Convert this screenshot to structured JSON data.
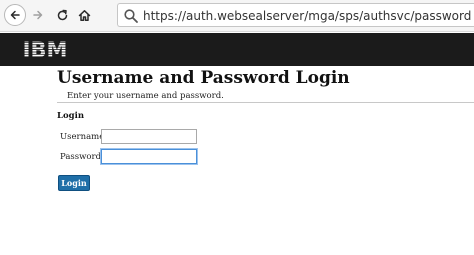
{
  "browser": {
    "url": "https://auth.websealserver/mga/sps/authsvc/password",
    "icons": {
      "back": "back-arrow-icon",
      "forward": "forward-arrow-icon",
      "reload": "reload-icon",
      "home": "home-icon",
      "search": "search-icon"
    }
  },
  "banner": {
    "logo": "IBM",
    "background_color": "#1b1b1b"
  },
  "page": {
    "title": "Username and Password Login",
    "instructions": "Enter your username and password."
  },
  "login_form": {
    "section_label": "Login",
    "username_label": "Username:",
    "username_value": "",
    "password_label": "Password:",
    "password_value": "",
    "submit_label": "Login",
    "accent_color": "#1f6fa8"
  }
}
